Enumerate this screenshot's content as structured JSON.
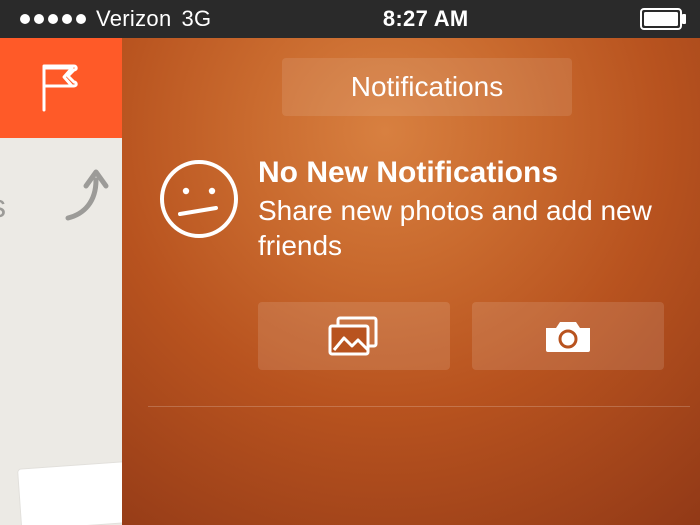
{
  "status_bar": {
    "carrier": "Verizon",
    "network": "3G",
    "time": "8:27 AM"
  },
  "sidebar": {
    "peek_text": "s"
  },
  "header": {
    "title": "Notifications"
  },
  "empty_state": {
    "title": "No New Notifications",
    "subtitle": "Share new photos and add new friends"
  },
  "icons": {
    "flag": "flag-icon",
    "arrow": "curved-arrow-icon",
    "face": "neutral-face-icon",
    "photos": "photos-icon",
    "camera": "camera-icon",
    "battery": "battery-icon",
    "signal": "signal-strength-icon"
  }
}
